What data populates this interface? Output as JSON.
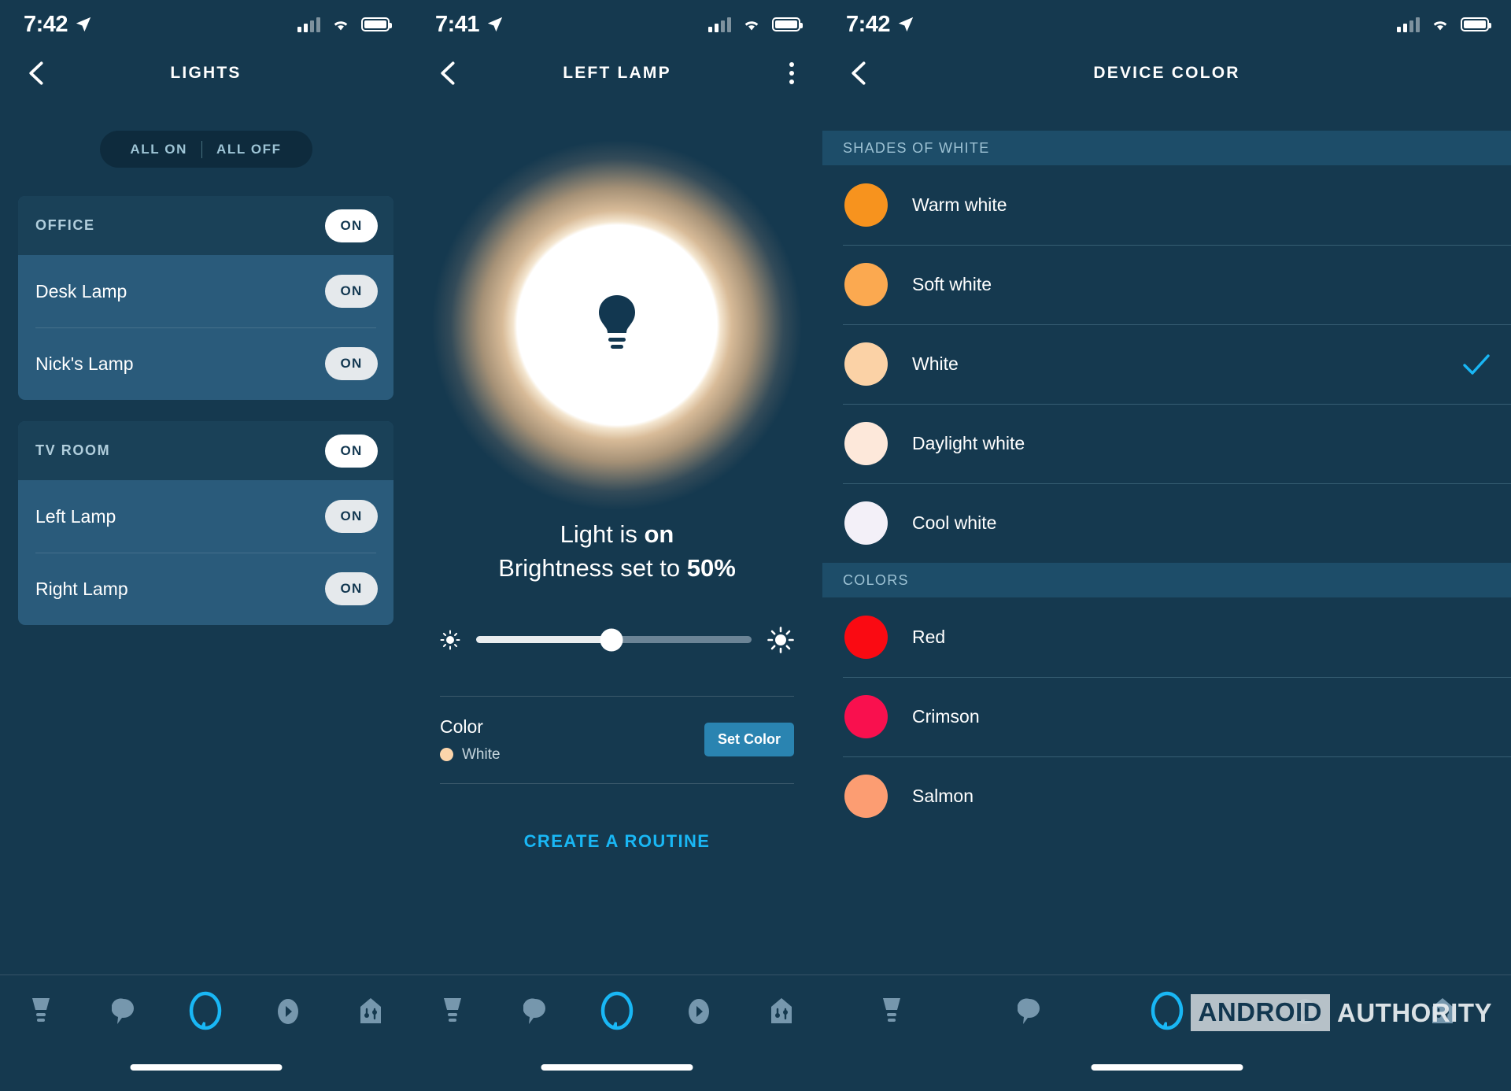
{
  "screens": [
    {
      "status": {
        "time": "7:42",
        "location_icon": "location-arrow-icon"
      },
      "nav": {
        "back_icon": "chevron-left-icon",
        "title": "LIGHTS"
      },
      "segmented": {
        "all_on": "ALL ON",
        "all_off": "ALL OFF"
      },
      "groups": [
        {
          "name": "OFFICE",
          "state": "ON",
          "devices": [
            {
              "name": "Desk Lamp",
              "state": "ON"
            },
            {
              "name": "Nick's Lamp",
              "state": "ON"
            }
          ]
        },
        {
          "name": "TV ROOM",
          "state": "ON",
          "devices": [
            {
              "name": "Left Lamp",
              "state": "ON"
            },
            {
              "name": "Right Lamp",
              "state": "ON"
            }
          ]
        }
      ]
    },
    {
      "status": {
        "time": "7:41",
        "location_icon": "location-arrow-icon"
      },
      "nav": {
        "back_icon": "chevron-left-icon",
        "title": "LEFT LAMP",
        "overflow_icon": "kebab-menu-icon"
      },
      "bulb": {
        "icon": "light-bulb-icon"
      },
      "state_line_1_prefix": "Light is ",
      "state_line_1_value": "on",
      "state_line_2_prefix": "Brightness set to ",
      "state_line_2_value": "50%",
      "slider": {
        "low_icon": "brightness-low-icon",
        "high_icon": "brightness-high-icon",
        "percent": 50
      },
      "color": {
        "label": "Color",
        "value": "White",
        "swatch_hex": "#fbd5ab",
        "button": "Set Color"
      },
      "routine": "CREATE A ROUTINE"
    },
    {
      "status": {
        "time": "7:42",
        "location_icon": "location-arrow-icon"
      },
      "nav": {
        "back_icon": "chevron-left-icon",
        "title": "DEVICE COLOR"
      },
      "sections": [
        {
          "header": "SHADES OF WHITE",
          "items": [
            {
              "label": "Warm white",
              "hex": "#f7931e",
              "selected": false
            },
            {
              "label": "Soft white",
              "hex": "#fba950",
              "selected": false
            },
            {
              "label": "White",
              "hex": "#fbd2a6",
              "selected": true
            },
            {
              "label": "Daylight white",
              "hex": "#fde8da",
              "selected": false
            },
            {
              "label": "Cool white",
              "hex": "#f3f0f8",
              "selected": false
            }
          ]
        },
        {
          "header": "COLORS",
          "items": [
            {
              "label": "Red",
              "hex": "#fa0a12",
              "selected": false
            },
            {
              "label": "Crimson",
              "hex": "#f9104e",
              "selected": false
            },
            {
              "label": "Salmon",
              "hex": "#fc9d72",
              "selected": false
            }
          ]
        }
      ],
      "selected_check_color": "#19b7f5"
    }
  ],
  "bottom_nav": {
    "items": [
      {
        "name": "lamp-icon",
        "label": "Devices",
        "active": false
      },
      {
        "name": "chat-bubble-icon",
        "label": "Communicate",
        "active": false
      },
      {
        "name": "alexa-ring-icon",
        "label": "Alexa",
        "active": true
      },
      {
        "name": "play-icon",
        "label": "Play",
        "active": false
      },
      {
        "name": "smart-home-icon",
        "label": "Home",
        "active": false
      }
    ],
    "active_hex": "#19b7f5",
    "inactive_hex": "#7697ad"
  },
  "watermark": {
    "brand": "ANDROID",
    "word": "AUTHORITY"
  }
}
